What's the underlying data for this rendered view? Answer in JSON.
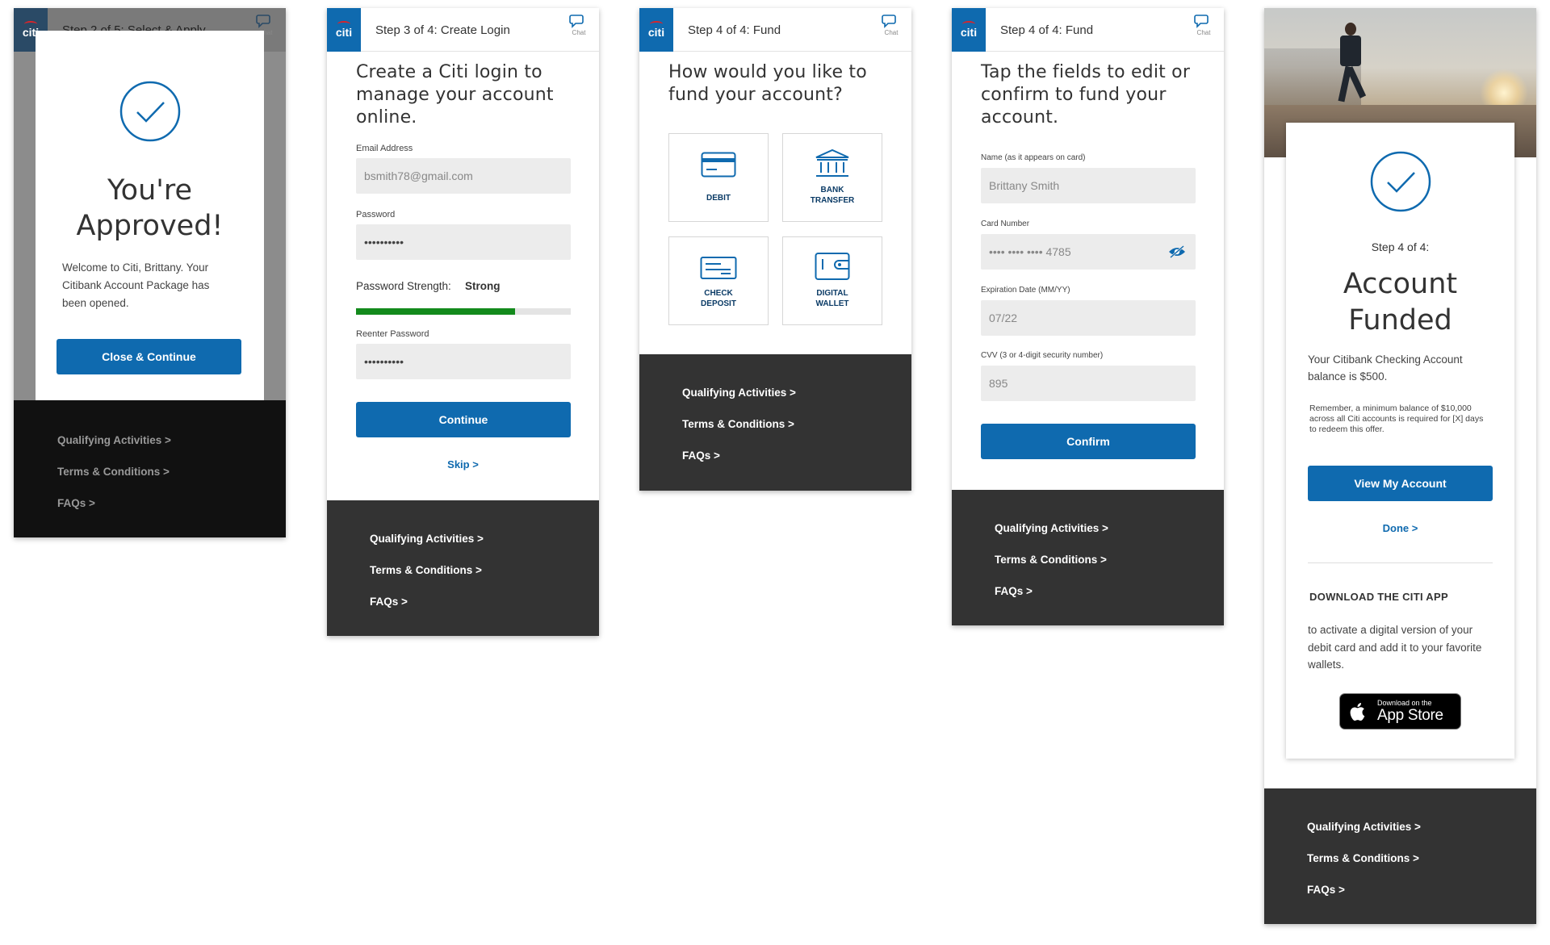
{
  "brand": {
    "logo": "citi",
    "color": "#0f6aaf",
    "footer_color": "#333333"
  },
  "chat_label": "Chat",
  "footer_links": [
    "Qualifying Activities >",
    "Terms & Conditions >",
    "FAQs >"
  ],
  "screen1": {
    "step_title": "Step 2 of 5: Select & Apply",
    "heading_line1": "You're",
    "heading_line2": "Approved!",
    "message": "Welcome to Citi, Brittany. Your Citibank Account Package has been opened.",
    "button": "Close & Continue"
  },
  "screen2": {
    "step_title": "Step 3 of 4: Create Login",
    "heading": [
      "Create a Citi login to",
      "manage your account",
      "online."
    ],
    "email_label": "Email Address",
    "email_value": "bsmith78@gmail.com",
    "password_label": "Password",
    "password_value": "••••••••••",
    "strength_label": "Password Strength:",
    "strength_value": "Strong",
    "strength_percent": 74,
    "reenter_label": "Reenter Password",
    "reenter_value": "••••••••••",
    "button": "Continue",
    "skip": "Skip >"
  },
  "screen3": {
    "step_title": "Step 4 of 4: Fund",
    "heading": [
      "How would you like to",
      "fund your account?"
    ],
    "options": [
      {
        "icon": "debit-card-icon",
        "label1": "DEBIT",
        "label2": ""
      },
      {
        "icon": "bank-icon",
        "label1": "BANK",
        "label2": "TRANSFER"
      },
      {
        "icon": "check-icon",
        "label1": "CHECK",
        "label2": "DEPOSIT"
      },
      {
        "icon": "wallet-icon",
        "label1": "DIGITAL",
        "label2": "WALLET"
      }
    ]
  },
  "screen4": {
    "step_title": "Step 4 of 4: Fund",
    "heading": [
      "Tap the fields to edit or",
      "confirm to fund your",
      "account."
    ],
    "name_label": "Name (as it appears on card)",
    "name_value": "Brittany Smith",
    "card_label": "Card Number",
    "card_value": "•••• •••• •••• 4785",
    "exp_label": "Expiration Date (MM/YY)",
    "exp_value": "07/22",
    "cvv_label": "CVV (3 or 4-digit security number)",
    "cvv_value": "895",
    "button": "Confirm"
  },
  "screen5": {
    "step_label": "Step 4 of 4:",
    "heading_line1": "Account",
    "heading_line2": "Funded",
    "balance_text": "Your Citibank Checking Account balance is $500.",
    "reminder": "Remember, a minimum balance of $10,000 across all Citi accounts is required for [X] days to redeem this offer.",
    "button": "View My Account",
    "done": "Done >",
    "download_title": "DOWNLOAD THE CITI APP",
    "download_text": "to activate a digital version of your debit card and add it to your favorite wallets.",
    "appstore_small": "Download on the",
    "appstore_big": "App Store"
  }
}
